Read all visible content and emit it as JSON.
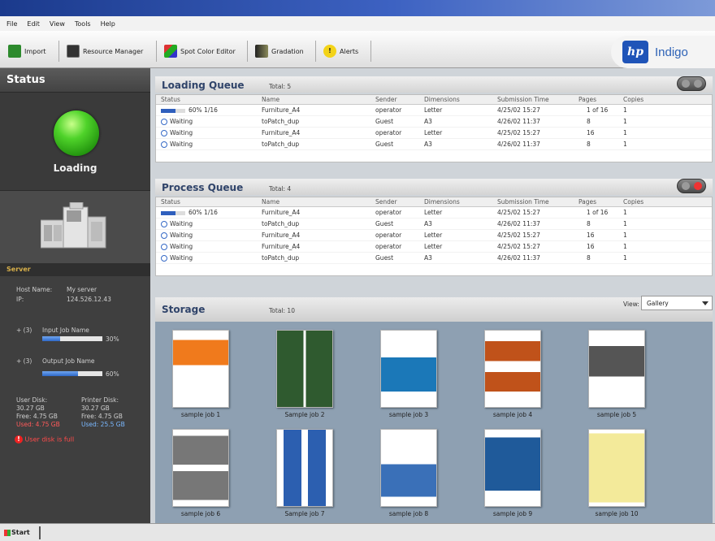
{
  "menu": [
    "File",
    "Edit",
    "View",
    "Tools",
    "Help"
  ],
  "toolbar": {
    "import": "Import",
    "resource_manager": "Resource Manager",
    "spot_color_editor": "Spot Color Editor",
    "gradation": "Gradation",
    "alerts": "Alerts"
  },
  "brand": {
    "logo": "hp",
    "product": "Indigo"
  },
  "status": {
    "title": "Status",
    "state": "Loading",
    "server_section": "Server",
    "host_name_label": "Host Name:",
    "host_name": "My server",
    "ip_label": "IP:",
    "ip": "124.526.12.43",
    "input_job": "Input Job Name",
    "input_count": "+ (3)",
    "input_pct": "30%",
    "input_progress": 0.3,
    "output_job": "Output Job Name",
    "output_count": "+ (3)",
    "output_pct": "60%",
    "output_progress": 0.6,
    "user_disk_title": "User Disk:",
    "user_disk_total": "30.27 GB",
    "user_disk_free": "Free: 4.75 GB",
    "user_disk_used": "Used: 4.75 GB",
    "printer_disk_title": "Printer Disk:",
    "printer_disk_total": "30.27 GB",
    "printer_disk_free": "Free: 4.75 GB",
    "printer_disk_used": "Used: 25.5 GB",
    "alert": "User disk is full"
  },
  "columns": [
    "Status",
    "Name",
    "Sender",
    "Dimensions",
    "Submission Time",
    "Pages",
    "Copies"
  ],
  "loading_queue": {
    "title": "Loading Queue",
    "total": "Total: 5",
    "rows": [
      {
        "status": "60%  1/16",
        "progress": 0.6,
        "name": "Furniture_A4",
        "sender": "operator",
        "dim": "Letter",
        "time": "4/25/02   15:27",
        "pages": "1 of 16",
        "copies": "1"
      },
      {
        "status": "Waiting",
        "name": "toPatch_dup",
        "sender": "Guest",
        "dim": "A3",
        "time": "4/26/02   11:37",
        "pages": "8",
        "copies": "1"
      },
      {
        "status": "Waiting",
        "name": "Furniture_A4",
        "sender": "operator",
        "dim": "Letter",
        "time": "4/25/02   15:27",
        "pages": "16",
        "copies": "1"
      },
      {
        "status": "Waiting",
        "name": "toPatch_dup",
        "sender": "Guest",
        "dim": "A3",
        "time": "4/26/02   11:37",
        "pages": "8",
        "copies": "1"
      }
    ]
  },
  "process_queue": {
    "title": "Process Queue",
    "total": "Total: 4",
    "rows": [
      {
        "status": "60%  1/16",
        "progress": 0.6,
        "name": "Furniture_A4",
        "sender": "operator",
        "dim": "Letter",
        "time": "4/25/02   15:27",
        "pages": "1 of 16",
        "copies": "1"
      },
      {
        "status": "Waiting",
        "name": "toPatch_dup",
        "sender": "Guest",
        "dim": "A3",
        "time": "4/26/02   11:37",
        "pages": "8",
        "copies": "1"
      },
      {
        "status": "Waiting",
        "name": "Furniture_A4",
        "sender": "operator",
        "dim": "Letter",
        "time": "4/25/02   15:27",
        "pages": "16",
        "copies": "1"
      },
      {
        "status": "Waiting",
        "name": "Furniture_A4",
        "sender": "operator",
        "dim": "Letter",
        "time": "4/25/02   15:27",
        "pages": "16",
        "copies": "1"
      },
      {
        "status": "Waiting",
        "name": "toPatch_dup",
        "sender": "Guest",
        "dim": "A3",
        "time": "4/26/02   11:37",
        "pages": "8",
        "copies": "1"
      }
    ]
  },
  "storage": {
    "title": "Storage",
    "total": "Total: 10",
    "view_label": "View:",
    "view_value": "Gallery",
    "jobs": [
      "sample job 1",
      "Sample job 2",
      "sample job 3",
      "sample job 4",
      "sample job 5",
      "sample job 6",
      "Sample job 7",
      "sample job 8",
      "sample job 9",
      "sample job 10"
    ]
  },
  "taskbar": {
    "start": "Start"
  },
  "colors": {
    "accent": "#2f5fbd",
    "status_green": "#4fd32a",
    "alert_red": "#e22222",
    "panel_dark": "#3f3f3f"
  }
}
